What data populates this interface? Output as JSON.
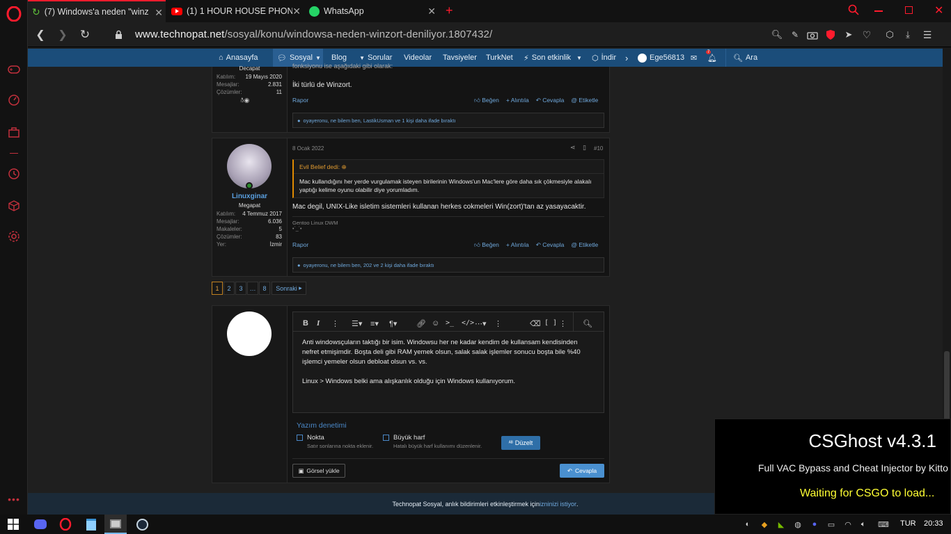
{
  "tabs": [
    {
      "title": "(7) Windows'a neden \"winz",
      "favicon": "technopat-icon"
    },
    {
      "title": "(1) 1 HOUR HOUSE PHONK",
      "favicon": "youtube-icon"
    },
    {
      "title": "WhatsApp",
      "favicon": "whatsapp-icon"
    }
  ],
  "address": {
    "domain": "www.technopat.net",
    "path": "/sosyal/konu/windowsa-neden-winzort-deniliyor.1807432/"
  },
  "sitenav": {
    "items": [
      "Anasayfa",
      "Sosyal",
      "Blog",
      "Sorular",
      "Videolar",
      "Tavsiyeler",
      "TurkNet",
      "Son etkinlik",
      "İndir"
    ],
    "user": "Ege56813",
    "alerts": "7",
    "search": "Ara"
  },
  "post1": {
    "rank": "Decapat",
    "stats": [
      [
        "Katılım:",
        "19 Mayıs 2020"
      ],
      [
        "Mesajlar:",
        "2.831"
      ],
      [
        "Çözümler:",
        "11"
      ]
    ],
    "text_top": "fonksiyonu ise aşağıdaki gibi olarak:",
    "text": "İki türlü de Winzort.",
    "report": "Rapor",
    "actions": [
      "Beğen",
      "Alıntıla",
      "Cevapla",
      "Etiketle"
    ],
    "reactions": "oyayeronu, ne bilem ben, LastikUsman ve 1 kişi daha ifade bıraktı"
  },
  "post2": {
    "date": "8 Ocak 2022",
    "num": "#10",
    "username": "Linuxginar",
    "rank": "Megapat",
    "stats": [
      [
        "Katılım:",
        "4 Temmuz 2017"
      ],
      [
        "Mesajlar:",
        "6.036"
      ],
      [
        "Makaleler:",
        "5"
      ],
      [
        "Çözümler:",
        "83"
      ],
      [
        "Yer:",
        "İzmir"
      ]
    ],
    "quote_author": "Evil Belief dedi:",
    "quote_text": "Mac kullandığını her yerde vurgulamak isteyen birilerinin Windows'un Mac'lere göre daha sık çökmesiyle alakalı yaptığı kelime oyunu olabilir diye yorumladım.",
    "text": "Mac degil, UNIX-Like isletim sistemleri kullanan herkes cokmeleri Win(zort)'tan az yasayacaktir.",
    "signature": "Gentoo Linux DWM",
    "signature2": "•`_´•",
    "report": "Rapor",
    "actions": [
      "Beğen",
      "Alıntıla",
      "Cevapla",
      "Etiketle"
    ],
    "reactions": "oyayeronu, ne bilem ben, 202 ve 2 kişi daha ifade bıraktı"
  },
  "pagination": {
    "pages": [
      "1",
      "2",
      "3",
      "…",
      "8"
    ],
    "next": "Sonraki"
  },
  "editor": {
    "line1": "Anti windowsçuların taktığı bir isim. Windowsu her ne kadar kendim de kullansam kendisinden",
    "line2": "nefret etmişimdir. Boşta deli gibi RAM yemek olsun, salak salak işlemler sonucu boşta bile %40",
    "line3": "işlemci yemeler olsun debloat olsun vs. vs.",
    "line4": "Linux > Windows belki ama alışkanlık olduğu için Windows kullanıyorum.",
    "spell_title": "Yazım denetimi",
    "opt1_label": "Nokta",
    "opt1_desc": "Satır sonlarına nokta eklenir.",
    "opt2_label": "Büyük harf",
    "opt2_desc": "Hatalı büyük harf kullanımı düzenlenir.",
    "fix_button": "Düzelt",
    "upload_button": "Görsel yükle",
    "reply_button": "Cevapla"
  },
  "footer": {
    "text": "Technopat Sosyal, anlık bildirimleri etkinleştirmek için ",
    "link": "izninizi istiyor",
    "end": "."
  },
  "csghost": {
    "title": "CSGhost v4.3.1",
    "subtitle": "Full VAC Bypass and Cheat Injector by Kitto",
    "status": "Waiting for CSGO to load..."
  },
  "taskbar": {
    "lang": "TUR",
    "time": "20:33"
  },
  "colors": {
    "accent": "#1b4d7a",
    "link": "#6fa8dc",
    "opera_red": "#ff1b2d",
    "status_yellow": "#ffff33"
  }
}
